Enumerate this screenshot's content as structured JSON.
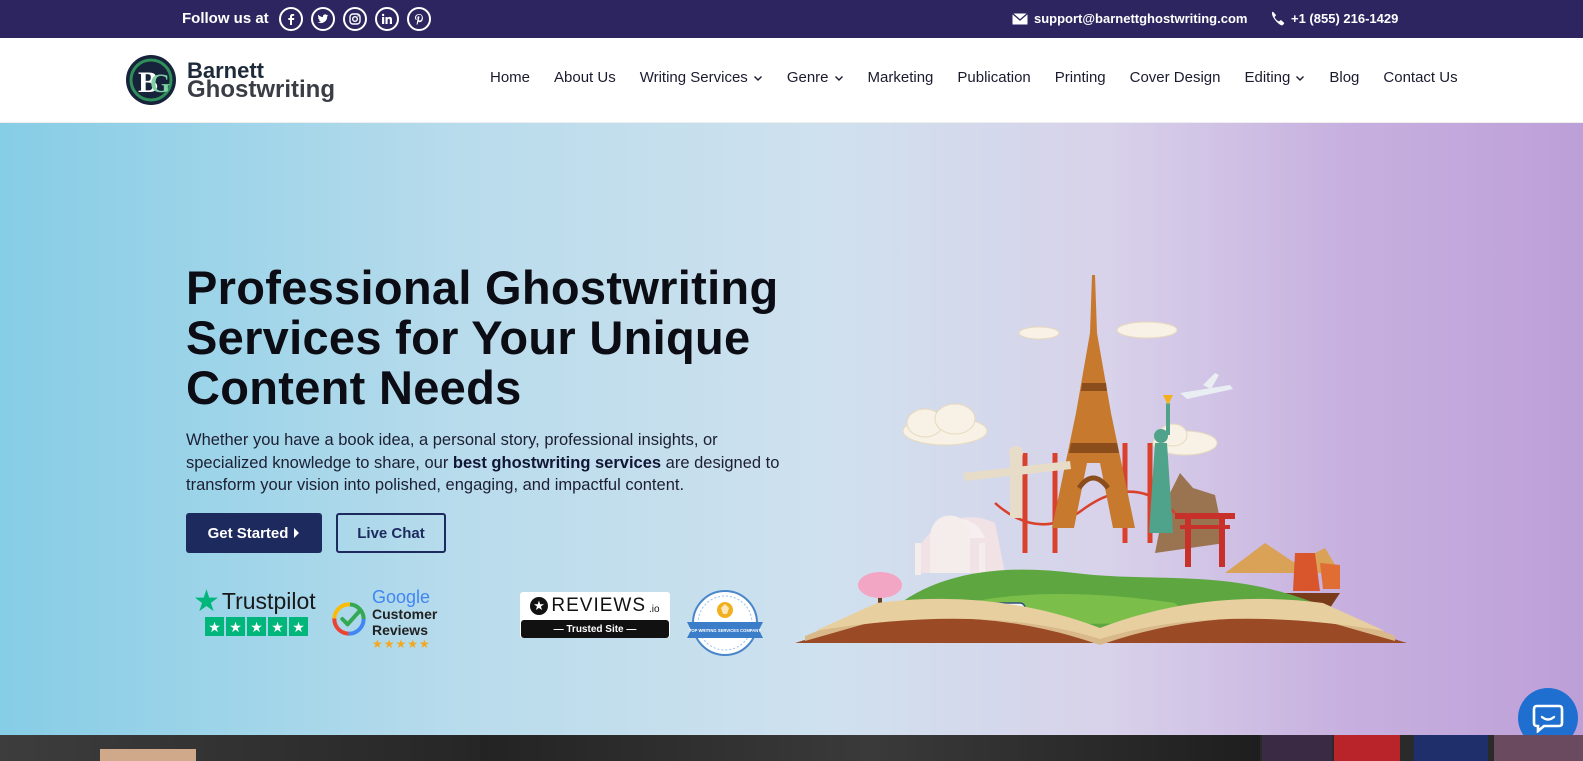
{
  "topbar": {
    "follow_label": "Follow us at",
    "socials": [
      "facebook-icon",
      "twitter-icon",
      "instagram-icon",
      "linkedin-icon",
      "pinterest-icon"
    ],
    "email": "support@barnettghostwriting.com",
    "phone": "+1 (855) 216-1429"
  },
  "logo": {
    "line1": "Barnett",
    "line2": "Ghostwriting"
  },
  "nav": {
    "items": [
      {
        "label": "Home",
        "dropdown": false
      },
      {
        "label": "About Us",
        "dropdown": false
      },
      {
        "label": "Writing Services",
        "dropdown": true
      },
      {
        "label": "Genre",
        "dropdown": true
      },
      {
        "label": "Marketing",
        "dropdown": false
      },
      {
        "label": "Publication",
        "dropdown": false
      },
      {
        "label": "Printing",
        "dropdown": false
      },
      {
        "label": "Cover Design",
        "dropdown": false
      },
      {
        "label": "Editing",
        "dropdown": true
      },
      {
        "label": "Blog",
        "dropdown": false
      },
      {
        "label": "Contact Us",
        "dropdown": false
      }
    ]
  },
  "hero": {
    "title_line1": "Professional Ghostwriting",
    "title_line2": "Services for Your Unique",
    "title_line3": "Content Needs",
    "desc_part1": "Whether you have a book idea, a personal story, professional insights, or specialized knowledge to share, our ",
    "desc_bold": "best ghostwriting services",
    "desc_part2": " are designed to transform your vision into polished, engaging, and impactful content.",
    "primary_button": "Get Started",
    "secondary_button": "Live Chat"
  },
  "badges": {
    "trustpilot": "Trustpilot",
    "google_line1": "Google",
    "google_line2": "Customer Reviews",
    "google_stars": "★★★★★",
    "reviews_brand": "REVIEWS",
    "reviews_suffix": ".io",
    "reviews_tagline": "— Trusted Site —",
    "seal_text": "TOP WRITING SERVICES COMPANY"
  },
  "colors": {
    "topbar_bg": "#2d2560",
    "primary": "#1d2a5e",
    "trustpilot_green": "#00b67a",
    "chat_blue": "#1f6fd1"
  }
}
